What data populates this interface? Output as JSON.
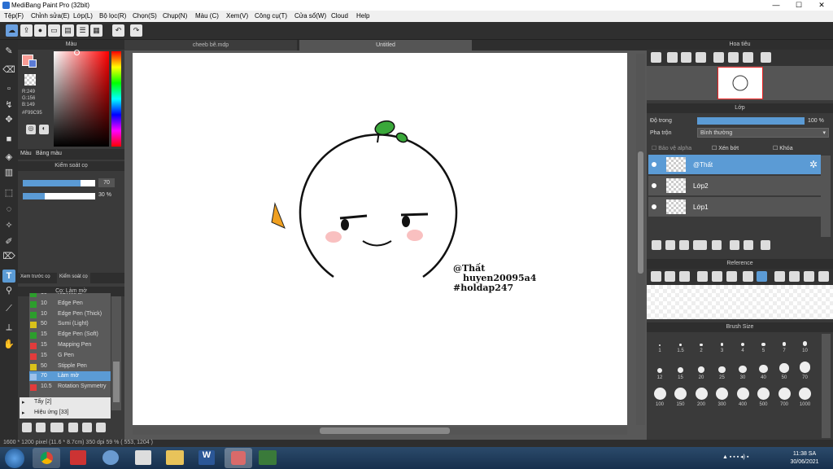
{
  "window": {
    "title": "MediBang Paint Pro (32bit)",
    "min": "—",
    "max": "☐",
    "close": "✕"
  },
  "menu": [
    "Tệp(F)",
    "Chỉnh sửa(E)",
    "Lớp(L)",
    "Bộ lọc(R)",
    "Chọn(S)",
    "Chụp(N)",
    "Màu (C)",
    "Xem(V)",
    "Công cụ(T)",
    "Cửa sổ(W)",
    "Cloud",
    "Help"
  ],
  "color_panel": {
    "title": "Màu",
    "r": "R:249",
    "g": "G:156",
    "b": "B:149",
    "hex": "#F99C95",
    "tab_color": "Màu",
    "tab_palette": "Bảng màu",
    "primary": "#f99c95",
    "secondary": "#5b7bd5"
  },
  "control_panel": {
    "title": "Kiểm soát cọ",
    "size": "70",
    "opacity": "30 %",
    "tab_preview": "Xem trước cọ",
    "tab_control": "Kiểm soát cọ"
  },
  "brush_panel": {
    "title": "Cọ: Làm mờ",
    "items": [
      {
        "val": "10",
        "name": "NORMAL",
        "color": "#2c9e2c"
      },
      {
        "val": "10",
        "name": "Edge Pen",
        "color": "#2c9e2c"
      },
      {
        "val": "10",
        "name": "Edge Pen (Thick)",
        "color": "#2c9e2c"
      },
      {
        "val": "50",
        "name": "Sumi (Light)",
        "color": "#d9c21a"
      },
      {
        "val": "15",
        "name": "Edge Pen (Soft)",
        "color": "#2c9e2c"
      },
      {
        "val": "15",
        "name": "Mapping Pen",
        "color": "#e23b3b"
      },
      {
        "val": "15",
        "name": "G Pen",
        "color": "#e23b3b"
      },
      {
        "val": "50",
        "name": "Stipple Pen",
        "color": "#d9c21a"
      },
      {
        "val": "70",
        "name": "Làm mờ",
        "color": "#9ec1ea"
      },
      {
        "val": "10.5",
        "name": "Rotation Symmetry",
        "color": "#e23b3b"
      }
    ],
    "group1": "Tẩy [2]",
    "group2": "Hiệu ứng [33]"
  },
  "tabs": [
    {
      "label": "cheeb bê.mdp"
    },
    {
      "label": "Untitled"
    }
  ],
  "canvas_text": {
    "line1": "@Thất",
    "line2": "huyen20095a4",
    "line3": "#holdap247"
  },
  "navigator": {
    "title": "Hoa tiêu"
  },
  "layer_panel": {
    "title": "Lớp",
    "opacity_label": "Độ trong",
    "opacity_value": "100 %",
    "blend_label": "Pha trộn",
    "blend_value": "Bình thường",
    "protect_alpha": "Bảo vệ alpha",
    "clip": "Xén bớt",
    "lock": "Khóa",
    "layers": [
      {
        "name": "@Thất",
        "selected": true
      },
      {
        "name": "Lớp2",
        "selected": false
      },
      {
        "name": "Lớp1",
        "selected": false
      }
    ]
  },
  "reference": {
    "title": "Reference"
  },
  "brush_size": {
    "title": "Brush Size",
    "sizes": [
      "1",
      "1.5",
      "2",
      "3",
      "4",
      "5",
      "7",
      "10",
      "12",
      "15",
      "20",
      "25",
      "30",
      "40",
      "50",
      "70",
      "100",
      "150",
      "200",
      "300",
      "400",
      "500",
      "700",
      "1000"
    ]
  },
  "status": {
    "text": "1600 * 1200 pixel   (11.6 * 8.7cm)   350 dpi   59 %   ( 553, 1204 )"
  },
  "taskbar": {
    "time": "11:38 SA",
    "date": "30/06/2021"
  }
}
